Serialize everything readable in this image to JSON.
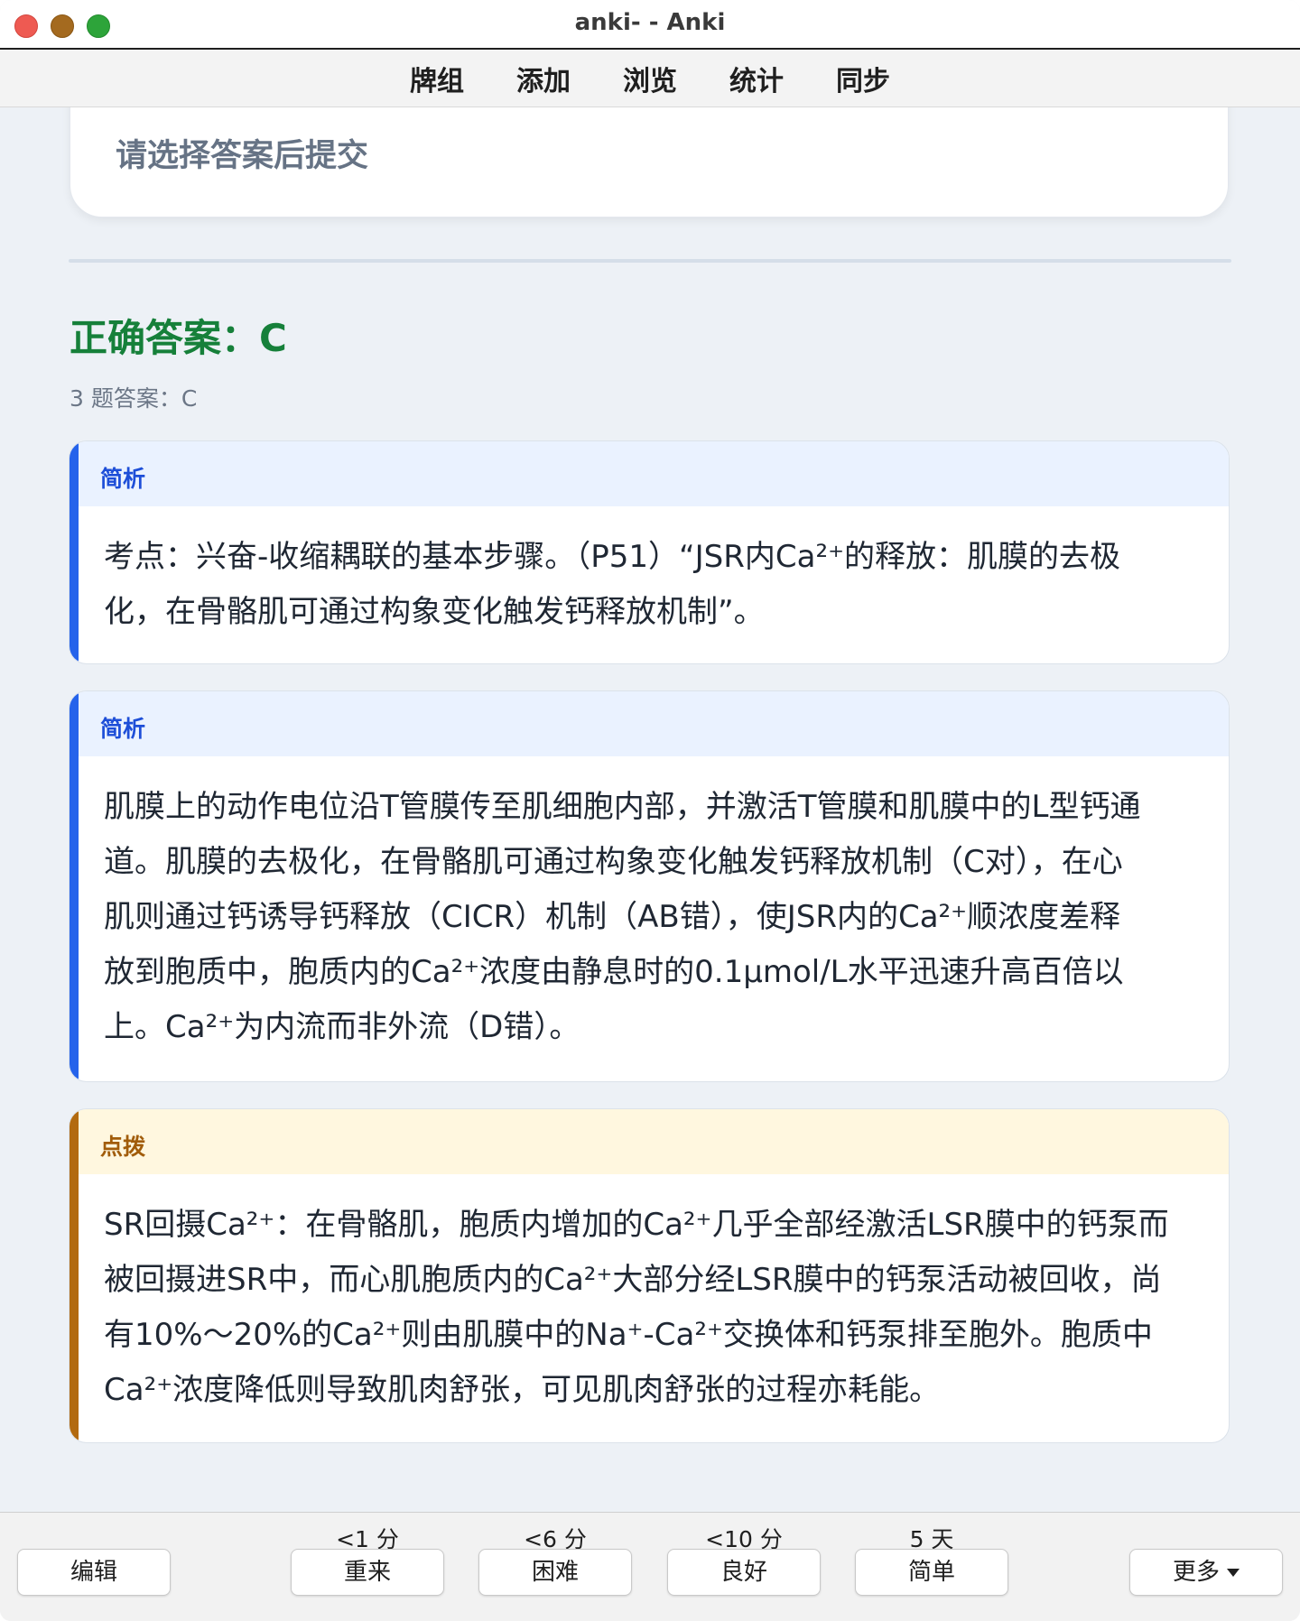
{
  "window": {
    "title": "anki- - Anki"
  },
  "topnav": {
    "items": [
      "牌组",
      "添加",
      "浏览",
      "统计",
      "同步"
    ]
  },
  "card": {
    "prompt": "请选择答案后提交",
    "answer_title": "正确答案：C",
    "answer_sub": "3 题答案：C",
    "sections": [
      {
        "type": "简析",
        "color": "#2563eb",
        "lines": [
          "考点：兴奋-收缩耦联的基本步骤。（P51）“JSR内Ca²⁺的释放：肌膜的去极",
          "化，在骨骼肌可通过构象变化触发钙释放机制”。"
        ]
      },
      {
        "type": "简析",
        "color": "#2563eb",
        "lines": [
          "肌膜上的动作电位沿T管膜传至肌细胞内部，并激活T管膜和肌膜中的L型钙通",
          "道。肌膜的去极化，在骨骼肌可通过构象变化触发钙释放机制（C对），在心",
          "肌则通过钙诱导钙释放（CICR）机制（AB错），使JSR内的Ca²⁺顺浓度差释",
          "放到胞质中，胞质内的Ca²⁺浓度由静息时的0.1μmol/L水平迅速升高百倍以",
          "上。Ca²⁺为内流而非外流（D错）。"
        ]
      },
      {
        "type": "点拨",
        "color": "#b26a10",
        "lines": [
          "SR回摄Ca²⁺：在骨骼肌，胞质内增加的Ca²⁺几乎全部经激活LSR膜中的钙泵而",
          "被回摄进SR中，而心肌胞质内的Ca²⁺大部分经LSR膜中的钙泵活动被回收，尚",
          "有10%～20%的Ca²⁺则由肌膜中的Na⁺-Ca²⁺交换体和钙泵排至胞外。胞质中",
          "Ca²⁺浓度降低则导致肌肉舒张，可见肌肉舒张的过程亦耗能。"
        ]
      }
    ]
  },
  "bottombar": {
    "edit_label": "编辑",
    "more_label": "更多",
    "ease": [
      {
        "interval": "<1 分",
        "label": "重来"
      },
      {
        "interval": "<6 分",
        "label": "困难"
      },
      {
        "interval": "<10 分",
        "label": "良好"
      },
      {
        "interval": "5 天",
        "label": "简单"
      }
    ]
  }
}
